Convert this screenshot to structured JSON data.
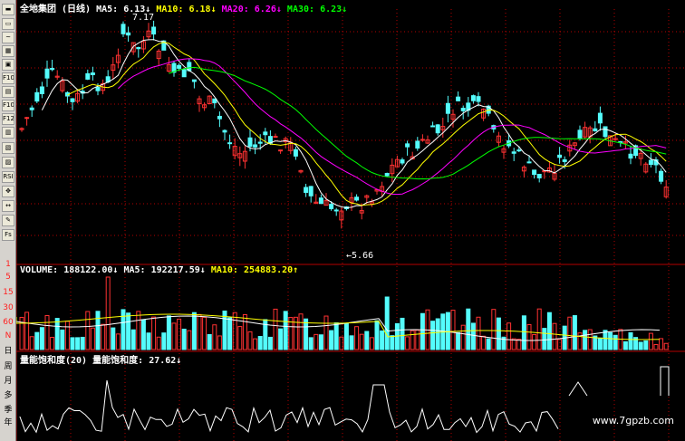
{
  "stock": {
    "title": "全地集团 (日线)",
    "ma5_label": "MA5:",
    "ma5_value": "6.13↓",
    "ma10_label": "MA10:",
    "ma10_value": "6.18↓",
    "ma20_label": "MA20:",
    "ma20_value": "6.26↓",
    "ma30_label": "MA30:",
    "ma30_value": "6.23↓",
    "high_label": "7.17",
    "low_label": "5.66"
  },
  "volume": {
    "label": "VOLUME:",
    "value": "188122.00↓",
    "ma5_label": "MA5:",
    "ma5_value": "192217.59↓",
    "ma10_label": "MA10:",
    "ma10_value": "254883.20↑",
    "axis": [
      "5",
      "15",
      "30",
      "60",
      "N"
    ]
  },
  "indicator": {
    "title": "量能饱和度(20)",
    "label": "量能饱和度:",
    "value": "27.62↓"
  },
  "toolbar": {
    "buttons": [
      "▬",
      "▭",
      "~",
      "▦",
      "▣",
      "F10",
      "▤",
      "F10",
      "F12",
      "▥",
      "▧",
      "▨",
      "RSI",
      "✥",
      "↔",
      "✎",
      "Fs"
    ],
    "period_labels": [
      "1",
      "5",
      "15",
      "30",
      "60",
      "N",
      "日",
      "周",
      "月",
      "多",
      "季",
      "年"
    ]
  },
  "watermark": "www.7gpzb.com",
  "colors": {
    "up": "#ff3232",
    "down": "#54fcfc",
    "ma5": "#ffffff",
    "ma10": "#ffff00",
    "ma20": "#ff00ff",
    "ma30": "#00ff00",
    "grid": "#b40000"
  }
}
